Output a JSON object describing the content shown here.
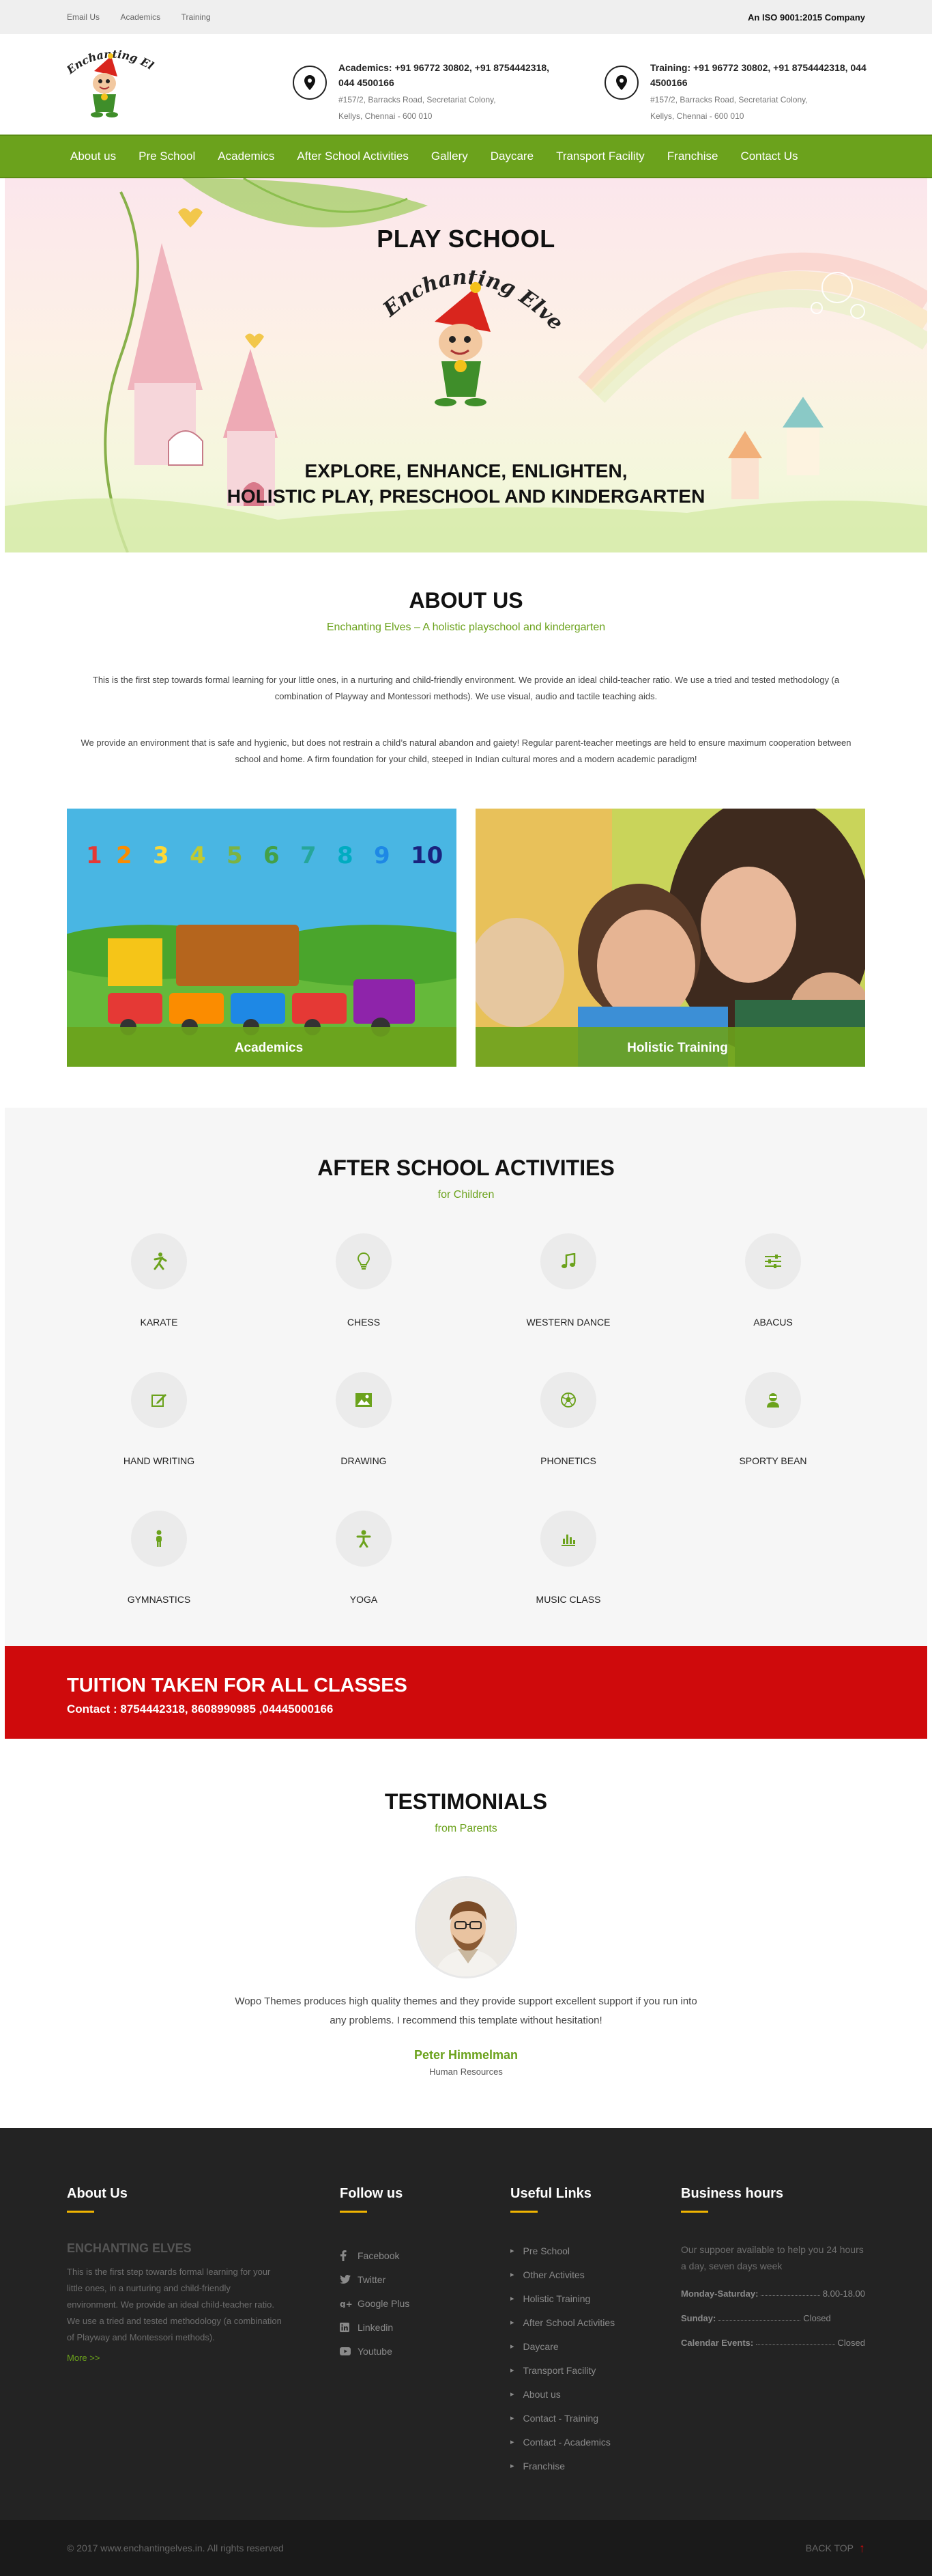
{
  "topbar": {
    "links": [
      "Email Us",
      "Academics",
      "Training"
    ],
    "iso": "An ISO 9001:2015 Company"
  },
  "logo": {
    "text": "Enchanting Elves"
  },
  "contacts": [
    {
      "title": "Academics: +91 96772 30802, +91 8754442318, 044 4500166",
      "address": "#157/2, Barracks Road, Secretariat Colony, Kellys, Chennai - 600 010"
    },
    {
      "title": "Training: +91 96772 30802, +91 8754442318, 044 4500166",
      "address": "#157/2, Barracks Road, Secretariat Colony, Kellys, Chennai - 600 010"
    }
  ],
  "nav": [
    "About us",
    "Pre School",
    "Academics",
    "After School Activities",
    "Gallery",
    "Daycare",
    "Transport Facility",
    "Franchise",
    "Contact Us"
  ],
  "hero": {
    "title": "PLAY SCHOOL",
    "logo_text": "Enchanting Elves",
    "tagline1": "EXPLORE, ENHANCE, ENLIGHTEN,",
    "tagline2": "HOLISTIC PLAY, PRESCHOOL AND KINDERGARTEN"
  },
  "about": {
    "title": "ABOUT US",
    "subtitle": "Enchanting Elves – A holistic playschool and kindergarten",
    "p1": "This is the first step towards formal learning for your little ones, in a nurturing and child-friendly environment. We provide an ideal child-teacher ratio. We use a tried and tested methodology (a combination of Playway and Montessori  methods). We use visual, audio and tactile teaching aids.",
    "p2": "We provide an environment that is safe and hygienic, but does not restrain a child’s natural abandon and gaiety!  Regular parent-teacher meetings are held to ensure maximum cooperation between school and home.  A firm foundation for your child, steeped in Indian cultural mores and a modern academic paradigm!",
    "card_numbers": [
      "1",
      "2",
      "3",
      "4",
      "5",
      "6",
      "7",
      "8",
      "9",
      "10"
    ],
    "cards": [
      "Academics",
      "Holistic Training"
    ]
  },
  "activities": {
    "title": "AFTER SCHOOL ACTIVITIES",
    "subtitle": "for Children",
    "items": [
      {
        "label": "KARATE",
        "icon": "karate-icon"
      },
      {
        "label": "CHESS",
        "icon": "lightbulb-icon"
      },
      {
        "label": "WESTERN DANCE",
        "icon": "music-note-icon"
      },
      {
        "label": "ABACUS",
        "icon": "sliders-icon"
      },
      {
        "label": "HAND WRITING",
        "icon": "edit-icon"
      },
      {
        "label": "DRAWING",
        "icon": "picture-icon"
      },
      {
        "label": "PHONETICS",
        "icon": "soccer-ball-icon"
      },
      {
        "label": "SPORTY BEAN",
        "icon": "user-icon"
      },
      {
        "label": "GYMNASTICS",
        "icon": "person-icon"
      },
      {
        "label": "YOGA",
        "icon": "yoga-icon"
      },
      {
        "label": "MUSIC CLASS",
        "icon": "bar-chart-icon"
      }
    ]
  },
  "tuition": {
    "title": "TUITION TAKEN FOR ALL CLASSES",
    "contact": "Contact : 8754442318, 8608990985 ,04445000166"
  },
  "testimonials": {
    "title": "TESTIMONIALS",
    "subtitle": "from Parents",
    "quote": "Wopo Themes produces high quality themes and they provide support excellent support if you run into any problems. I recommend this template without hesitation!",
    "name": "Peter Himmelman",
    "role": "Human Resources"
  },
  "footer": {
    "about": {
      "title": "About Us",
      "brand": "ENCHANTING ELVES",
      "text": "This is the first step towards formal learning for your little ones, in a nurturing and child-friendly environment. We provide an ideal child-teacher ratio. We use a tried and tested methodology (a combination of Playway and Montessori methods).",
      "more": "More >>"
    },
    "follow": {
      "title": "Follow us",
      "items": [
        {
          "label": "Facebook",
          "icon": "facebook-icon"
        },
        {
          "label": "Twitter",
          "icon": "twitter-icon"
        },
        {
          "label": "Google Plus",
          "icon": "google-plus-icon"
        },
        {
          "label": "Linkedin",
          "icon": "linkedin-icon"
        },
        {
          "label": "Youtube",
          "icon": "youtube-icon"
        }
      ]
    },
    "links": {
      "title": "Useful Links",
      "items": [
        "Pre School",
        "Other Activites",
        "Holistic Training",
        "After School Activities",
        "Daycare",
        "Transport Facility",
        "About us",
        "Contact - Training",
        "Contact - Academics",
        "Franchise"
      ]
    },
    "hours": {
      "title": "Business hours",
      "intro": "Our suppoer available to help you 24 hours a day, seven days week",
      "rows": [
        {
          "label": "Monday-Saturday:",
          "value": "8.00-18.00"
        },
        {
          "label": "Sunday:",
          "value": "Closed"
        },
        {
          "label": "Calendar Events:",
          "value": "Closed"
        }
      ]
    }
  },
  "copyright": "© 2017 www.enchantingelves.in. All rights reserved",
  "backtop": "BACK TOP",
  "colors": {
    "green": "#6ba21c",
    "red": "#cf0a0c",
    "footer": "#232323",
    "yellow": "#f0b400"
  }
}
